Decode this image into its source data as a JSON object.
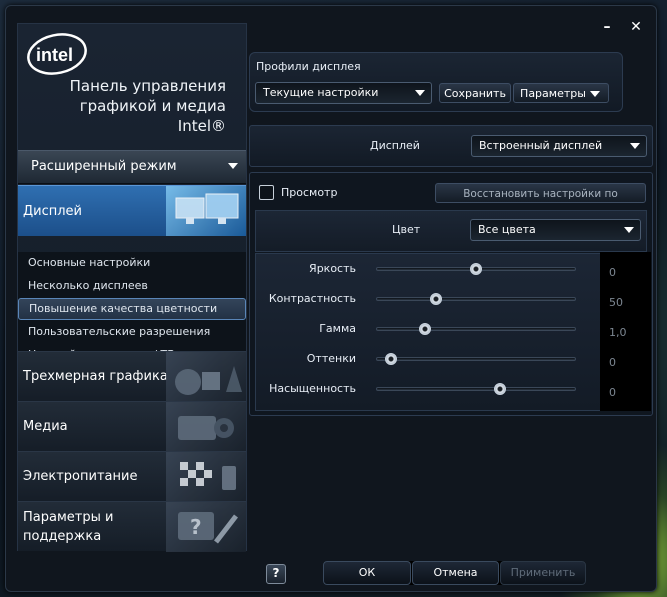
{
  "window": {
    "minimize_icon": "minimize-icon",
    "close_icon": "close-icon"
  },
  "brand": {
    "logo_text": "intel",
    "title_lines": [
      "Панель управления",
      "графикой и медиа",
      "Intel®"
    ]
  },
  "mode": {
    "label": "Расширенный режим"
  },
  "categories": [
    {
      "label": "Дисплей",
      "active": true
    },
    {
      "label": "Трехмерная графика"
    },
    {
      "label": "Медиа"
    },
    {
      "label": "Электропитание"
    },
    {
      "label_lines": [
        "Параметры и",
        "поддержка"
      ]
    }
  ],
  "display_subitems": [
    {
      "label": "Основные настройки"
    },
    {
      "label": "Несколько дисплеев"
    },
    {
      "label": "Повышение качества цветности",
      "selected": true
    },
    {
      "label": "Пользовательские разрешения"
    },
    {
      "label": "Настройки монитора / ТВ"
    }
  ],
  "profiles": {
    "title": "Профили дисплея",
    "current": "Текущие настройки",
    "save": "Сохранить",
    "params": "Параметры"
  },
  "display_select": {
    "label": "Дисплей",
    "value": "Встроенный дисплей"
  },
  "preview": {
    "label": "Просмотр",
    "checked": false,
    "restore": "Восстановить настройки по умолчанию"
  },
  "color": {
    "label": "Цвет",
    "value": "Все цвета"
  },
  "sliders": [
    {
      "label": "Яркость",
      "value": "0",
      "level": 0.5
    },
    {
      "label": "Контрастность",
      "value": "50",
      "level": 0.3
    },
    {
      "label": "Гамма",
      "value": "1,0",
      "level": 0.24
    },
    {
      "label": "Оттенки",
      "value": "0",
      "level": 0.07
    },
    {
      "label": "Насыщенность",
      "value": "0",
      "level": 0.62
    }
  ],
  "footer": {
    "help": "?",
    "ok": "ОК",
    "cancel": "Отмена",
    "apply": "Применить"
  },
  "colors": {
    "accent": "#2f6fb1",
    "panel": "#121a25",
    "border": "#2c3b50"
  }
}
